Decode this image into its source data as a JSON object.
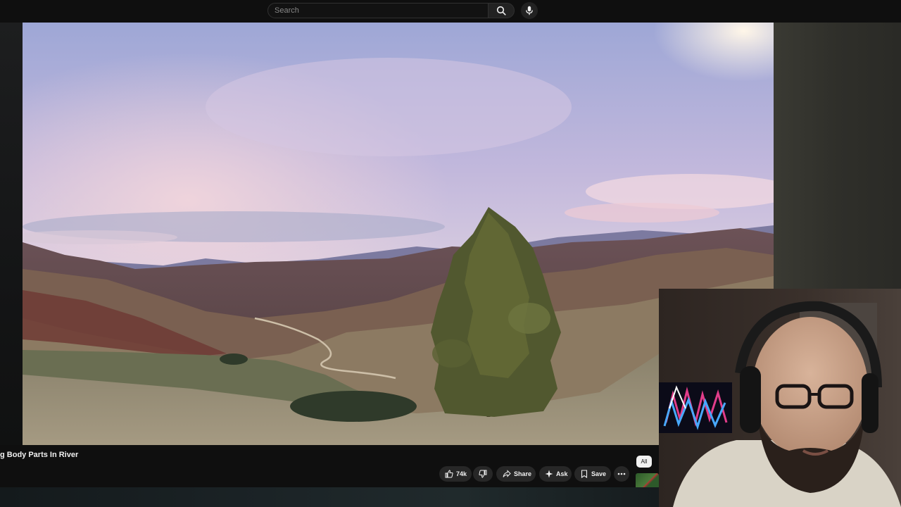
{
  "search": {
    "placeholder": "Search"
  },
  "video": {
    "title": "g Body Parts In River"
  },
  "actions": {
    "like_count": "74k",
    "share_label": "Share",
    "ask_label": "Ask",
    "save_label": "Save"
  },
  "chips": {
    "all_label": "All"
  }
}
